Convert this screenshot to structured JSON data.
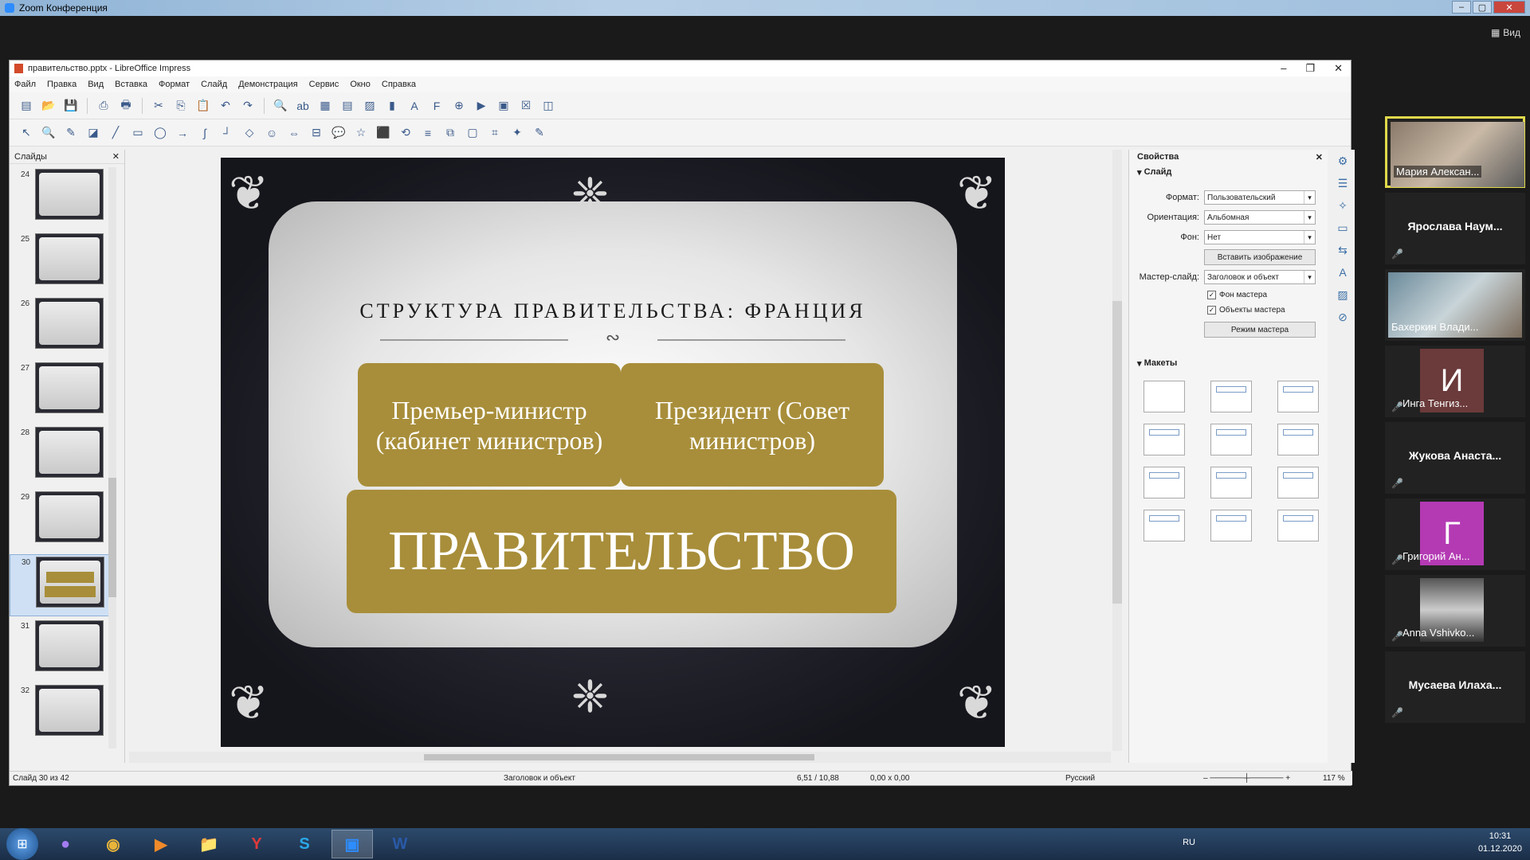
{
  "zoom": {
    "window_title": "Zoom Конференция",
    "view_label": "Вид"
  },
  "lo": {
    "window_title": "правительство.pptx - LibreOffice Impress",
    "menu": [
      "Файл",
      "Правка",
      "Вид",
      "Вставка",
      "Формат",
      "Слайд",
      "Демонстрация",
      "Сервис",
      "Окно",
      "Справка"
    ],
    "slides_panel_title": "Слайды",
    "slide_numbers": [
      "24",
      "25",
      "26",
      "27",
      "28",
      "29",
      "30",
      "31",
      "32"
    ],
    "active_slide": "30"
  },
  "slide": {
    "title": "СТРУКТУРА ПРАВИТЕЛЬСТВА: ФРАНЦИЯ",
    "box1": "Премьер-министр (кабинет министров)",
    "box2": "Президент (Совет министров)",
    "box3": "ПРАВИТЕЛЬСТВО",
    "accent_color": "#a88e3a"
  },
  "props": {
    "title": "Свойства",
    "section_slide": "Слайд",
    "format_label": "Формат:",
    "format_value": "Пользовательский",
    "orientation_label": "Ориентация:",
    "orientation_value": "Альбомная",
    "background_label": "Фон:",
    "background_value": "Нет",
    "insert_image_button": "Вставить изображение",
    "master_slide_label": "Мастер-слайд:",
    "master_slide_value": "Заголовок и объект",
    "master_background_check": "Фон мастера",
    "master_objects_check": "Объекты мастера",
    "master_mode_button": "Режим мастера",
    "section_layouts": "Макеты"
  },
  "status": {
    "slide_counter": "Слайд 30 из 42",
    "layout_name": "Заголовок и объект",
    "position": "6,51 / 10,88",
    "size": "0,00 x 0,00",
    "language": "Русский",
    "zoom": "117 %"
  },
  "participants": [
    {
      "name": "Мария Алексан...",
      "kind": "video"
    },
    {
      "name": "Ярослава Наум...",
      "kind": "name"
    },
    {
      "name": "Бахеркин Влади...",
      "kind": "video"
    },
    {
      "name": "Инга Тенгиз...",
      "kind": "avatar",
      "letter": "И",
      "color": "#6b3a3a"
    },
    {
      "name": "Жукова Анаста...",
      "kind": "name"
    },
    {
      "name": "Григорий Ан...",
      "kind": "avatar",
      "letter": "Г",
      "color": "#b43ab4"
    },
    {
      "name": "Anna Vshivko...",
      "kind": "video"
    },
    {
      "name": "Мусаева Илаха...",
      "kind": "name"
    }
  ],
  "taskbar": {
    "lang": "RU",
    "time": "10:31",
    "date": "01.12.2020"
  }
}
